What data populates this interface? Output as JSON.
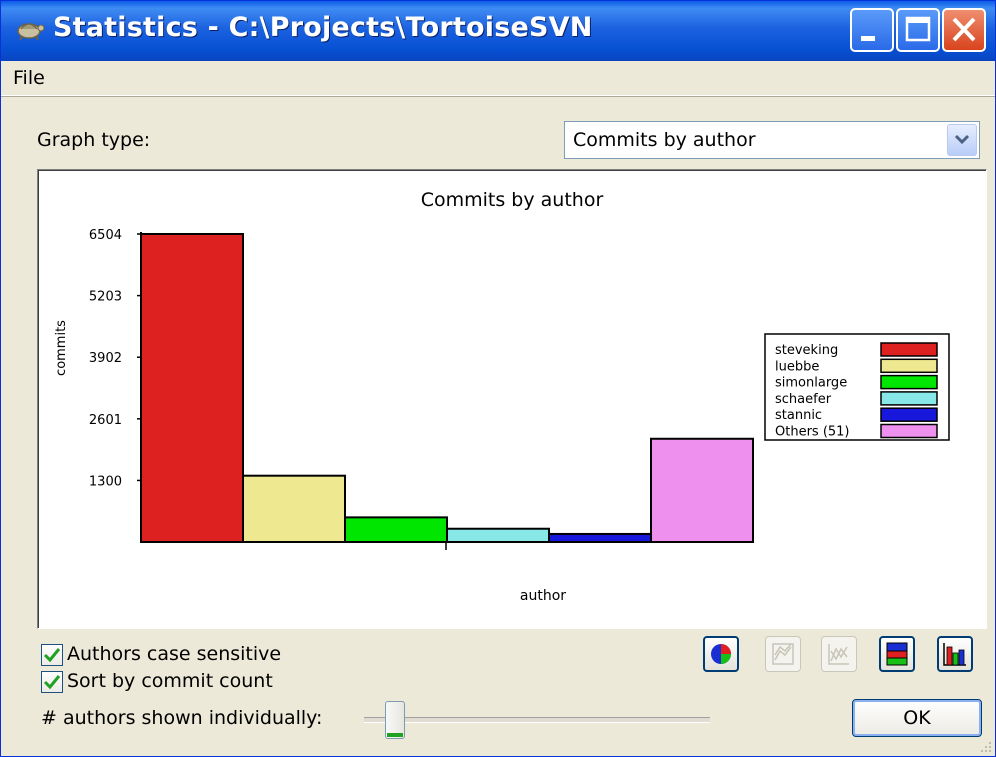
{
  "window": {
    "title": "Statistics - C:\\Projects\\TortoiseSVN",
    "icon": "tortoise-icon"
  },
  "menu": {
    "file": "File"
  },
  "graph_type": {
    "label": "Graph type:",
    "selected": "Commits by author"
  },
  "chart_data": {
    "type": "bar",
    "title": "Commits by author",
    "xlabel": "author",
    "ylabel": "commits",
    "yticks": [
      6504,
      5203,
      3902,
      2601,
      1300
    ],
    "ylim": [
      0,
      6504
    ],
    "series": [
      {
        "name": "steveking",
        "value": 6504,
        "color": "#dd2020"
      },
      {
        "name": "luebbe",
        "value": 1400,
        "color": "#eee890"
      },
      {
        "name": "simonlarge",
        "value": 520,
        "color": "#00e600"
      },
      {
        "name": "schaefer",
        "value": 280,
        "color": "#88e8e8"
      },
      {
        "name": "stannic",
        "value": 170,
        "color": "#1818dd"
      },
      {
        "name": "Others (51)",
        "value": 2180,
        "color": "#ee90ee"
      }
    ],
    "legend_position": "right"
  },
  "options": {
    "case_sensitive": {
      "label": "Authors case sensitive",
      "checked": true
    },
    "sort_by_count": {
      "label": "Sort by commit count",
      "checked": true
    }
  },
  "toolbar": {
    "buttons": [
      {
        "name": "pie-chart-icon",
        "enabled": true
      },
      {
        "name": "line-graph-icon",
        "enabled": false
      },
      {
        "name": "stacked-line-graph-icon",
        "enabled": false
      },
      {
        "name": "stacked-bar-icon",
        "enabled": true
      },
      {
        "name": "bar-chart-icon",
        "enabled": true
      }
    ]
  },
  "slider": {
    "label": "# authors shown individually:",
    "value_fraction": 0.07
  },
  "ok_label": "OK"
}
